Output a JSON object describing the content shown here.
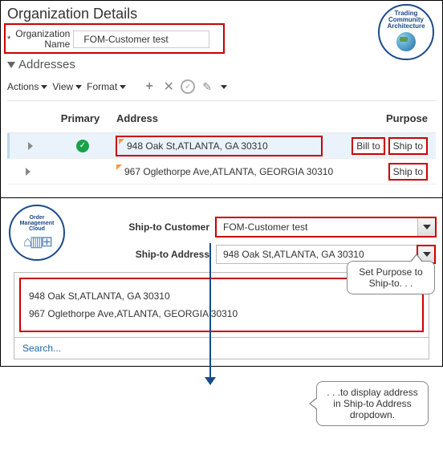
{
  "top": {
    "page_title": "Organization Details",
    "org_label": "Organization\nName",
    "org_value": "FOM-Customer test",
    "addresses_heading": "Addresses",
    "badge": {
      "line1": "Trading",
      "line2": "Community",
      "line3": "Architecture"
    },
    "toolbar": {
      "actions": "Actions",
      "view": "View",
      "format": "Format"
    },
    "columns": {
      "primary": "Primary",
      "address": "Address",
      "purpose": "Purpose"
    },
    "rows": [
      {
        "primary": true,
        "address": "948 Oak St,ATLANTA, GA 30310",
        "purposes": [
          "Bill to",
          "Ship to"
        ]
      },
      {
        "primary": false,
        "address": "967 Oglethorpe Ave,ATLANTA, GEORGIA 30310",
        "purposes": [
          "Ship to"
        ]
      }
    ],
    "callout": "Set Purpose to Ship-to. . ."
  },
  "bottom": {
    "badge": {
      "line1": "Order",
      "line2": "Management",
      "line3": "Cloud"
    },
    "shipto_customer_label": "Ship-to Customer",
    "shipto_customer_value": "FOM-Customer test",
    "shipto_address_label": "Ship-to Address",
    "shipto_address_value": "948 Oak St,ATLANTA, GA 30310",
    "dropdown_items": [
      "948 Oak St,ATLANTA, GA 30310",
      "967 Oglethorpe Ave,ATLANTA, GEORGIA 30310"
    ],
    "search": "Search...",
    "callout": ". . .to display address in Ship-to Address dropdown."
  }
}
